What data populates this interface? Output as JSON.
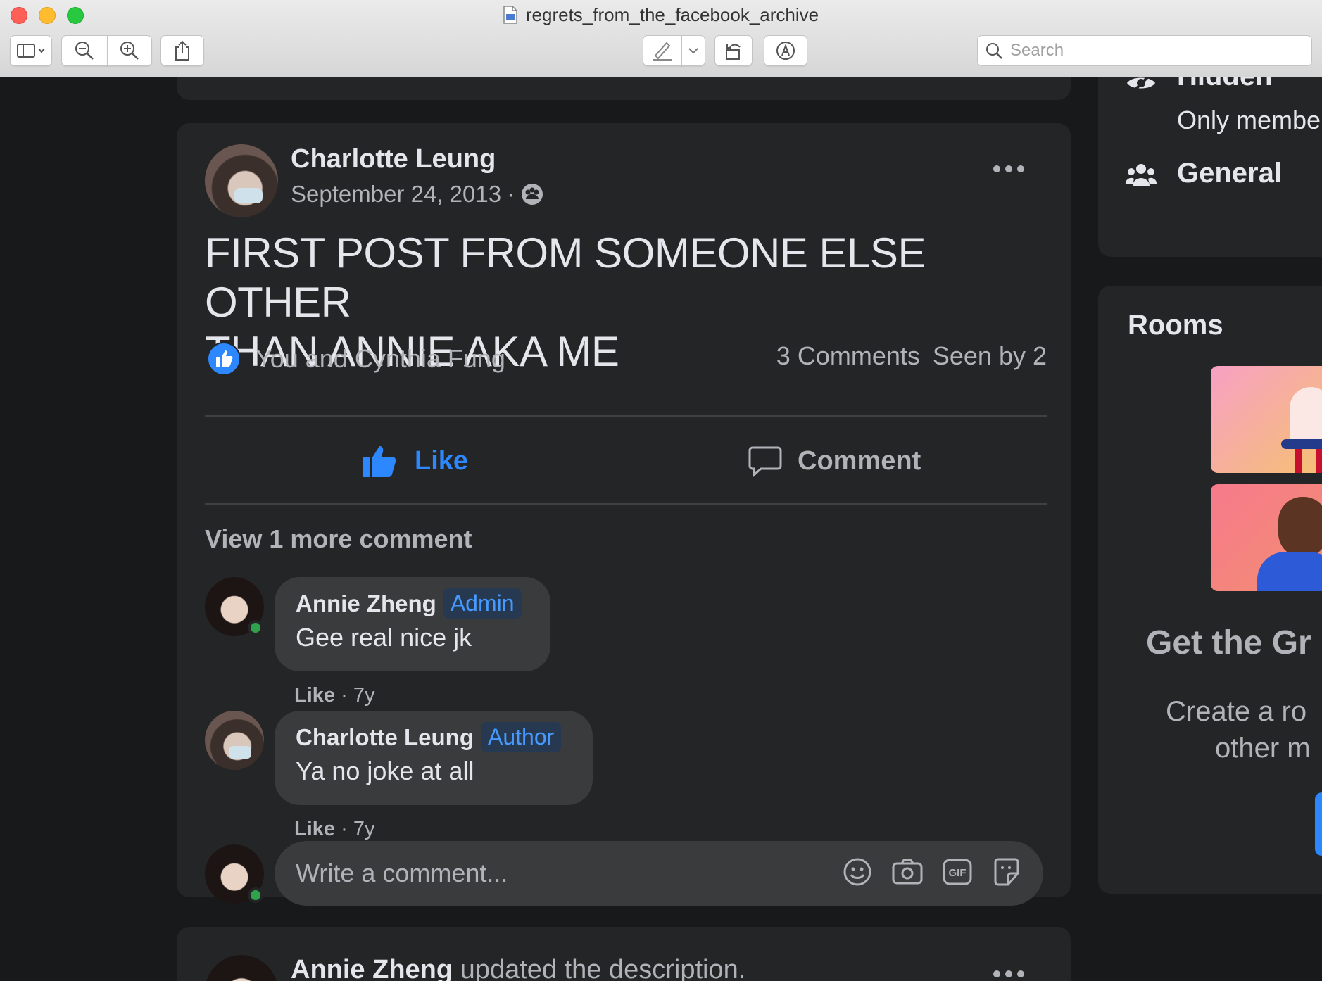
{
  "window": {
    "title": "regrets_from_the_facebook_archive",
    "search_placeholder": "Search"
  },
  "top_card_stub": {},
  "post": {
    "author": "Charlotte Leung",
    "date": "September 24, 2013",
    "meta_separator": "·",
    "privacy_icon": "group-icon",
    "text_line1": "FIRST POST FROM SOMEONE ELSE OTHER",
    "text_line2": "THAN ANNIE AKA ME",
    "reactions_text": "You and Cynthia Fung",
    "comments_count": "3 Comments",
    "seen_by": "Seen by 2",
    "like_label": "Like",
    "comment_label": "Comment",
    "view_more": "View 1 more comment",
    "comments": [
      {
        "name": "Annie Zheng",
        "badge": "Admin",
        "text": "Gee real nice jk",
        "like": "Like",
        "sep": "·",
        "time": "7y"
      },
      {
        "name": "Charlotte Leung",
        "badge": "Author",
        "text": "Ya no joke at all",
        "like": "Like",
        "sep": "·",
        "time": "7y"
      }
    ],
    "write_placeholder": "Write a comment..."
  },
  "next_post": {
    "author": "Annie Zheng",
    "action": "updated the description."
  },
  "sidebar": {
    "hidden_title": "Hidden",
    "hidden_sub": "Only membe",
    "general_title": "General",
    "rooms_title": "Rooms",
    "get_group": "Get the Gr",
    "create_line1": "Create a ro",
    "create_line2": "other m"
  },
  "colors": {
    "accent": "#2d88ff",
    "like_blue": "#4599ff",
    "background": "#18191a",
    "card": "#242526",
    "online": "#31a24c"
  }
}
